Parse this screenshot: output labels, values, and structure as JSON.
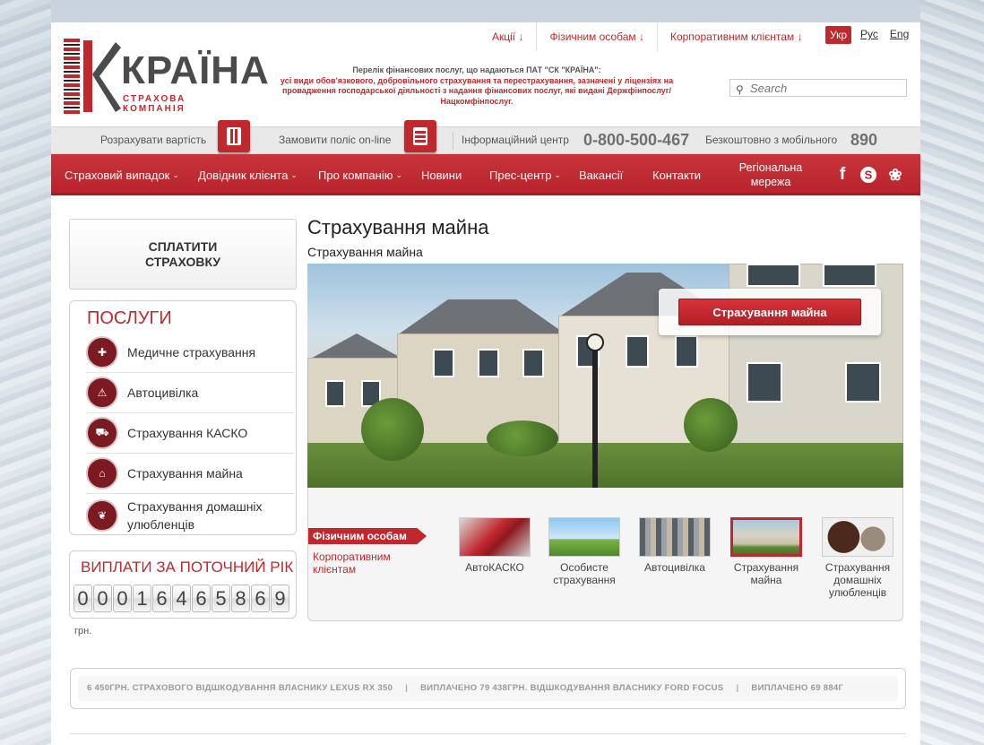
{
  "header": {
    "logo": {
      "name": "КРАЇНА",
      "subtitle": "СТРАХОВА КОМПАНІЯ"
    },
    "notice_title": "Перелік фінансових послуг, що надаються ПАТ \"СК \"КРАЇНА\":",
    "notice_text": "усі види обов'язкового, добровільного страхування та перестрахування, зазначені у ліцензіях на провадження господарської діяльності з надання фінансових послуг, які видані Держфінпослуг/Нацкомфінпослуг.",
    "top_links": [
      "Акції ↓",
      "Фізичним особам ↓",
      "Корпоративним клієнтам ↓"
    ],
    "languages": [
      {
        "label": "Укр",
        "active": true
      },
      {
        "label": "Рус",
        "active": false
      },
      {
        "label": "Eng",
        "active": false
      }
    ],
    "search_placeholder": "Search"
  },
  "action_bar": {
    "calc_label": "Розрахувати вартість",
    "order_label": "Замовити поліс on-line",
    "info_label": "Інформаційний центр",
    "info_phone": "0-800-500-467",
    "mobile_label": "Безкоштовно з мобільного",
    "mobile_phone": "890"
  },
  "nav": {
    "items": [
      {
        "label": "Страховий випадок",
        "chevron": "⌄"
      },
      {
        "label": "Довідник клієнта",
        "chevron": "⌄"
      },
      {
        "label": "Про компанію",
        "chevron": "⌄"
      },
      {
        "label": "Новини",
        "chevron": ""
      },
      {
        "label": "Прес-центр",
        "chevron": "⌄"
      },
      {
        "label": "Вакансії",
        "chevron": ""
      },
      {
        "label": "Контакти",
        "chevron": ""
      }
    ],
    "regional": "Регіональна мережа",
    "social_icons": [
      "facebook-icon",
      "skype-icon",
      "flower-icon"
    ]
  },
  "sidebar": {
    "pay_button": "СПЛАТИТИ СТРАХОВКУ",
    "services_title": "ПОСЛУГИ",
    "services": [
      {
        "label": "Медичне страхування",
        "icon": "medical-case-icon"
      },
      {
        "label": "Автоцивілка",
        "icon": "car-crash-icon"
      },
      {
        "label": "Страхування КАСКО",
        "icon": "car-icon"
      },
      {
        "label": "Страхування майна",
        "icon": "house-icon"
      },
      {
        "label": "Страхування домашніх улюбленців",
        "icon": "pet-icon"
      }
    ],
    "payments_title": "ВИПЛАТИ ЗА ПОТОЧНИЙ РІК",
    "counter_digits": [
      "0",
      "0",
      "0",
      "1",
      "6",
      "4",
      "6",
      "5",
      "8",
      "6",
      "9"
    ],
    "currency": "грн."
  },
  "main": {
    "title": "Страхування майна",
    "breadcrumb": "Страхування майна",
    "hero_button": "Страхування майна",
    "tab_individuals": "Фізичним особам",
    "tab_corporate": "Корпоративним клієнтам",
    "thumbnails": [
      {
        "label": "АвтоКАСКО",
        "active": false
      },
      {
        "label": "Особисте страхування",
        "active": false
      },
      {
        "label": "Автоцивілка",
        "active": false
      },
      {
        "label": "Страхування майна",
        "active": true
      },
      {
        "label": "Страхування домашніх улюбленців",
        "active": false
      }
    ]
  },
  "ticker": {
    "items": [
      "6 450ГРН. СТРАХОВОГО ВІДШКОДУВАННЯ ВЛАСНИКУ LEXUS RX 350",
      "ВИПЛАЧЕНО 79 438ГРН. ВІДШКОДУВАННЯ ВЛАСНИКУ FORD FOCUS",
      "ВИПЛАЧЕНО 69 884Г"
    ]
  },
  "colors": {
    "brand_red": "#c0282e",
    "nav_red": "#b8242b",
    "text_gray": "#555555"
  }
}
